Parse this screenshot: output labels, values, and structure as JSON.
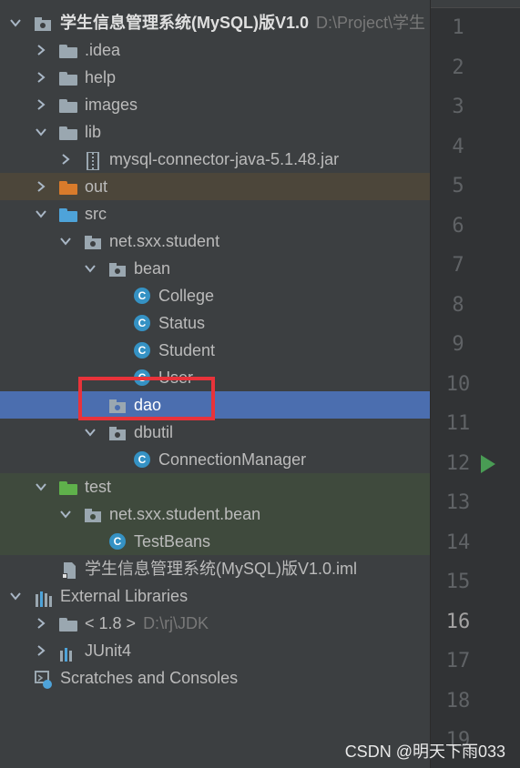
{
  "project": {
    "name": "学生信息管理系统(MySQL)版V1.0",
    "path": "D:\\Project\\学生"
  },
  "tree": [
    {
      "name": "idea",
      "label": ".idea"
    },
    {
      "name": "help",
      "label": "help"
    },
    {
      "name": "images",
      "label": "images"
    },
    {
      "name": "lib",
      "label": "lib"
    },
    {
      "name": "jar",
      "label": "mysql-connector-java-5.1.48.jar"
    },
    {
      "name": "out",
      "label": "out"
    },
    {
      "name": "src",
      "label": "src"
    },
    {
      "name": "pkg-student",
      "label": "net.sxx.student"
    },
    {
      "name": "bean",
      "label": "bean"
    },
    {
      "name": "college",
      "label": "College"
    },
    {
      "name": "status",
      "label": "Status"
    },
    {
      "name": "student",
      "label": "Student"
    },
    {
      "name": "user",
      "label": "User"
    },
    {
      "name": "dao",
      "label": "dao"
    },
    {
      "name": "dbutil",
      "label": "dbutil"
    },
    {
      "name": "connmgr",
      "label": "ConnectionManager"
    },
    {
      "name": "test",
      "label": "test"
    },
    {
      "name": "pkg-bean",
      "label": "net.sxx.student.bean"
    },
    {
      "name": "testbeans",
      "label": "TestBeans"
    },
    {
      "name": "iml",
      "label": "学生信息管理系统(MySQL)版V1.0.iml"
    }
  ],
  "external": {
    "label": "External Libraries",
    "jdk_label": "< 1.8 >",
    "jdk_path": "D:\\rj\\JDK",
    "junit_label": "JUnit4"
  },
  "scratches": "Scratches and Consoles",
  "gutter": {
    "lines": [
      "1",
      "2",
      "3",
      "4",
      "5",
      "6",
      "7",
      "8",
      "9",
      "10",
      "11",
      "12",
      "13",
      "14",
      "15",
      "16",
      "17",
      "18",
      "19"
    ],
    "current_line": "16"
  },
  "watermark": "CSDN @明天下雨033",
  "colors": {
    "selection": "#4b6eaf",
    "highlight_box": "#e8333a",
    "run_icon": "#499c54"
  }
}
